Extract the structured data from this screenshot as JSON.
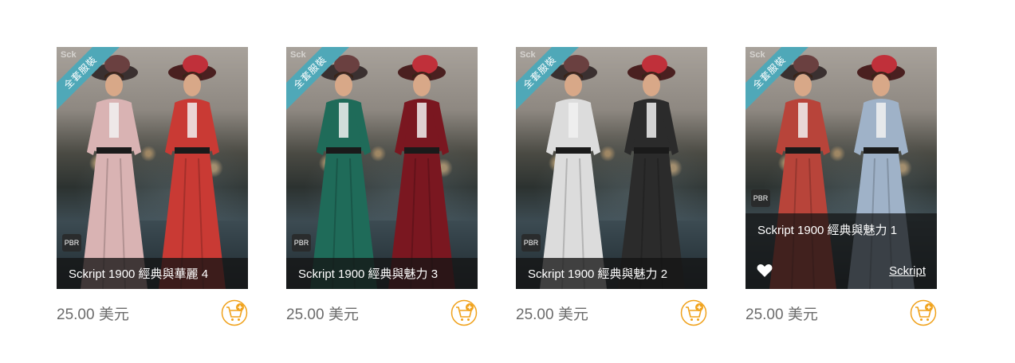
{
  "products": [
    {
      "badge": "全套服裝",
      "watermark": "Sck",
      "format": "PBR",
      "title": "Sckript 1900 經典與華麗 4",
      "price": "25.00 美元",
      "dress_colors": [
        "#d9b3b3",
        "#c93a34"
      ]
    },
    {
      "badge": "全套服裝",
      "watermark": "Sck",
      "format": "PBR",
      "title": "Sckript 1900 經典與魅力 3",
      "price": "25.00 美元",
      "dress_colors": [
        "#1f6b59",
        "#7a1720"
      ]
    },
    {
      "badge": "全套服裝",
      "watermark": "Sck",
      "format": "PBR",
      "title": "Sckript 1900 經典與魅力 2",
      "price": "25.00 美元",
      "dress_colors": [
        "#dcdcdc",
        "#2b2b2b"
      ]
    },
    {
      "badge": "全套服裝",
      "watermark": "Sck",
      "format": "PBR",
      "title": "Sckript 1900 經典與魅力 1",
      "price": "25.00 美元",
      "vendor": "Sckript",
      "dress_colors": [
        "#b8443a",
        "#9fb2c8"
      ]
    }
  ],
  "colors": {
    "ribbon": "#4fa8b8",
    "cart": "#f0a21c",
    "price": "#6b6b6b"
  },
  "icons": {
    "cart": "add-to-cart-icon",
    "wishlist": "heart-icon"
  }
}
